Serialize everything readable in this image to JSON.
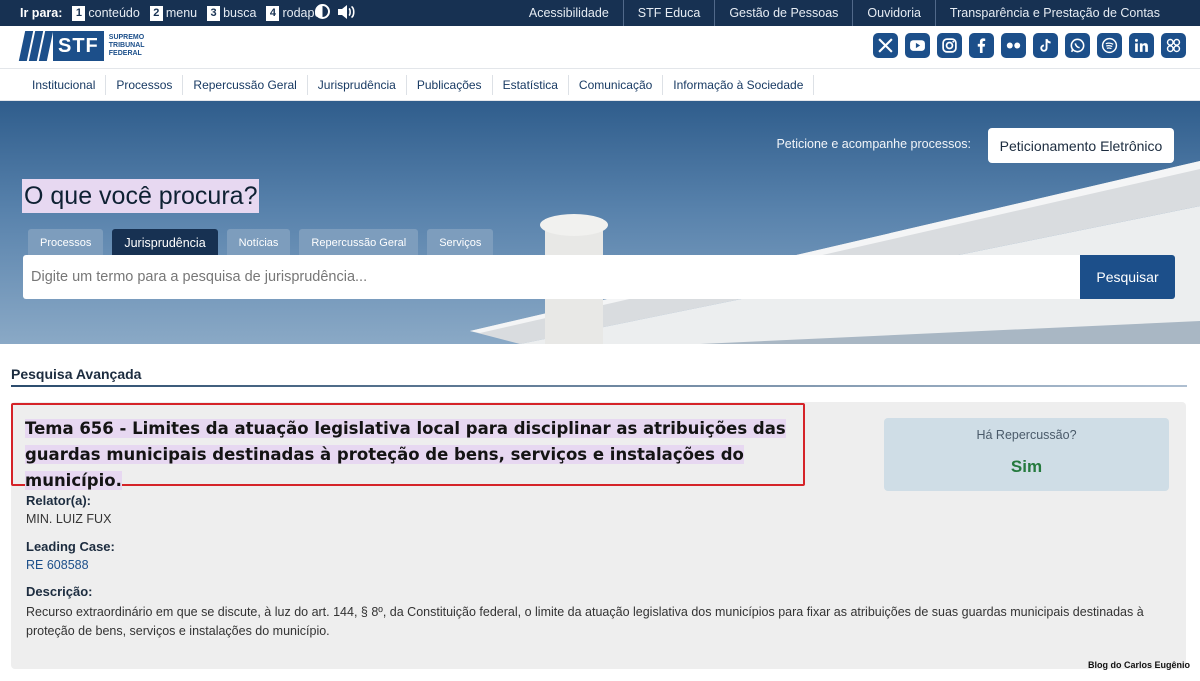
{
  "access_bar": {
    "label": "Ir para:",
    "skip_links": [
      {
        "key": "1",
        "label": "conteúdo"
      },
      {
        "key": "2",
        "label": "menu"
      },
      {
        "key": "3",
        "label": "busca"
      },
      {
        "key": "4",
        "label": "rodapé"
      }
    ],
    "top_links": [
      "Acessibilidade",
      "STF Educa",
      "Gestão de Pessoas",
      "Ouvidoria",
      "Transparência e Prestação de Contas"
    ]
  },
  "logo": {
    "text": "STF",
    "sub1": "SUPREMO",
    "sub2": "TRIBUNAL",
    "sub3": "FEDERAL"
  },
  "social_icons": [
    "x-icon",
    "youtube-icon",
    "instagram-icon",
    "facebook-icon",
    "flickr-icon",
    "tiktok-icon",
    "whatsapp-icon",
    "spotify-icon",
    "linkedin-icon",
    "apps-icon"
  ],
  "nav": [
    "Institucional",
    "Processos",
    "Repercussão Geral",
    "Jurisprudência",
    "Publicações",
    "Estatística",
    "Comunicação",
    "Informação à Sociedade"
  ],
  "hero": {
    "peticione_label": "Peticione e acompanhe processos:",
    "peticione_button": "Peticionamento Eletrônico",
    "question": "O que você procura?",
    "tabs": [
      "Processos",
      "Jurisprudência",
      "Notícias",
      "Repercussão Geral",
      "Serviços"
    ],
    "active_tab": "Jurisprudência",
    "search_placeholder": "Digite um termo para a pesquisa de jurisprudência...",
    "search_button": "Pesquisar"
  },
  "advanced": {
    "title": "Pesquisa Avançada"
  },
  "result": {
    "tema": "Tema 656 - Limites da atuação legislativa local para disciplinar as atribuições das guardas municipais destinadas à proteção de bens, serviços e instalações do município.",
    "repercussao_question": "Há Repercussão?",
    "repercussao_answer": "Sim",
    "relator_label": "Relator(a):",
    "relator_value": "MIN. LUIZ FUX",
    "leading_label": "Leading Case:",
    "leading_value": "RE 608588",
    "descricao_label": "Descrição:",
    "descricao_value": "Recurso extraordinário em que se discute, à luz do art. 144, § 8º, da Constituição federal, o limite da atuação legislativa dos municípios para fixar as atribuições de suas guardas municipais destinadas à proteção de bens, serviços e instalações do município."
  },
  "credit": "Blog do Carlos Eugênio",
  "colors": {
    "navy": "#173152",
    "brand": "#1c4f8a",
    "highlight": "#e7d8f1",
    "border_red": "#d52328",
    "yes_green": "#257a3e"
  }
}
